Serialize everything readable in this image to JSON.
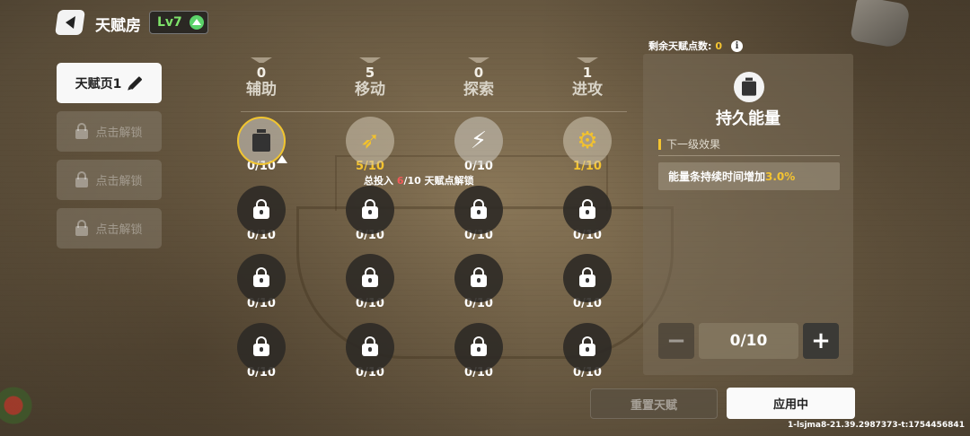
{
  "header": {
    "title": "天赋房",
    "level": "Lv7"
  },
  "sidebar": {
    "pages": [
      {
        "label": "天赋页1",
        "state": "active"
      },
      {
        "label": "点击解锁",
        "state": "locked"
      },
      {
        "label": "点击解锁",
        "state": "locked"
      },
      {
        "label": "点击解锁",
        "state": "locked"
      }
    ]
  },
  "categories": [
    {
      "points": "0",
      "name": "辅助"
    },
    {
      "points": "5",
      "name": "移动"
    },
    {
      "points": "0",
      "name": "探索"
    },
    {
      "points": "1",
      "name": "进攻"
    }
  ],
  "tree": {
    "unlock_hint_prefix": "总投入",
    "unlock_hint_current": "6",
    "unlock_hint_suffix": "/10 天赋点解锁",
    "rows": [
      [
        {
          "count": "0/10",
          "icon": "battery-up-icon",
          "state": "selected"
        },
        {
          "count": "5/10",
          "icon": "winged-boot-icon",
          "state": "invested"
        },
        {
          "count": "0/10",
          "icon": "running-figure-icon",
          "state": "open"
        },
        {
          "count": "1/10",
          "icon": "golden-gun-icon",
          "state": "invested"
        }
      ],
      [
        {
          "count": "0/10",
          "icon": "lock-icon",
          "state": "locked"
        },
        {
          "count": "0/10",
          "icon": "lock-icon",
          "state": "locked"
        },
        {
          "count": "0/10",
          "icon": "lock-icon",
          "state": "locked"
        },
        {
          "count": "0/10",
          "icon": "lock-icon",
          "state": "locked"
        }
      ],
      [
        {
          "count": "0/10",
          "icon": "lock-icon",
          "state": "locked"
        },
        {
          "count": "0/10",
          "icon": "lock-icon",
          "state": "locked"
        },
        {
          "count": "0/10",
          "icon": "lock-icon",
          "state": "locked"
        },
        {
          "count": "0/10",
          "icon": "lock-icon",
          "state": "locked"
        }
      ],
      [
        {
          "count": "0/10",
          "icon": "lock-icon",
          "state": "locked"
        },
        {
          "count": "0/10",
          "icon": "lock-icon",
          "state": "locked"
        },
        {
          "count": "0/10",
          "icon": "lock-icon",
          "state": "locked"
        },
        {
          "count": "0/10",
          "icon": "lock-icon",
          "state": "locked"
        }
      ]
    ]
  },
  "detail": {
    "remaining_label": "剩余天赋点数:",
    "remaining_value": "0",
    "talent_name": "持久能量",
    "next_level_label": "下一级效果",
    "effect_text": "能量条持续时间增加",
    "effect_value": "3.0%",
    "stepper_value": "0/10",
    "minus_label": "−",
    "plus_label": "+"
  },
  "actions": {
    "reset": "重置天赋",
    "apply": "应用中"
  },
  "build_id": "1-lsjma8-21.39.2987373-t:1754456841",
  "colors": {
    "accent_gold": "#f4c431",
    "highlight_red": "#f45a5a",
    "level_green": "#7ee26a"
  }
}
